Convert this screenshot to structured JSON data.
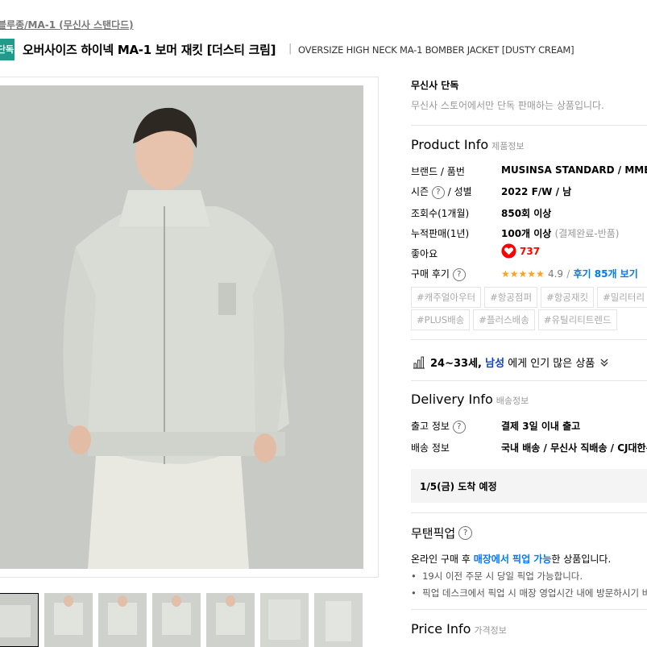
{
  "breadcrumb": "블루종/MA-1 (무신사 스탠다드)",
  "badge": "단독",
  "title_ko": "오버사이즈 하이넥 MA-1 보머 재킷 [더스티 크림]",
  "title_sep": "|",
  "title_en": "OVERSIZE HIGH NECK MA-1 BOMBER JACKET [DUSTY CREAM]",
  "exclusive": {
    "title": "무신사 단독",
    "desc": "무신사 스토어에서만 단독 판매하는 상품입니다."
  },
  "product_info": {
    "heading": "Product Info",
    "heading_sub": "제품정보",
    "rows": [
      {
        "label": "브랜드 / 품번",
        "value": "MUSINSA STANDARD / MMBUJ"
      },
      {
        "label": "시즌",
        "label2": "/ 성별",
        "value": "2022 F/W / 남"
      },
      {
        "label": "조회수(1개월)",
        "value": "850회 이상"
      },
      {
        "label": "누적판매(1년)",
        "value": "100개 이상",
        "value_note": "(결제완료-반품)"
      },
      {
        "label": "좋아요",
        "value": "737"
      },
      {
        "label": "구매 후기",
        "stars": "★★★★★",
        "rating": "4.9",
        "slash": "/",
        "value": "후기 85개 보기"
      }
    ],
    "tags": [
      "#캐주얼아우터",
      "#항공점퍼",
      "#항공재킷",
      "#밀리터리",
      "#PLUS배송",
      "#플러스배송",
      "#유틸리티트렌드"
    ]
  },
  "popular": {
    "age": "24~33세",
    "comma": ",",
    "gender": "남성",
    "text": "에게 인기 많은 상품"
  },
  "delivery": {
    "heading": "Delivery Info",
    "heading_sub": "배송정보",
    "ship_label": "출고 정보",
    "ship_value": "결제 3일 이내 출고",
    "method_label": "배송 정보",
    "method_value": "국내 배송 / 무신사 직배송 / CJ대한통",
    "arrival": "1/5(금) 도착 예정"
  },
  "pickup": {
    "heading": "무탠픽업",
    "line_pre": "온라인 구매 후",
    "line_hl": "매장에서 픽업 가능",
    "line_post": "한 상품입니다.",
    "bullets": [
      "19시 이전 주문 시 당일 픽업 가능합니다.",
      "픽업 데스크에서 픽업 시 매장 영업시간 내에 방문하시기 바"
    ]
  },
  "price": {
    "heading": "Price Info",
    "heading_sub": "가격정보"
  },
  "colors": {
    "accent": "#0078ff",
    "badge": "#1e9b8a",
    "heart": "#ff0000",
    "star": "#ffa11c"
  },
  "icons": [
    "question-icon",
    "heart-icon",
    "star-icon",
    "chart-icon",
    "chevron-down-icon"
  ]
}
